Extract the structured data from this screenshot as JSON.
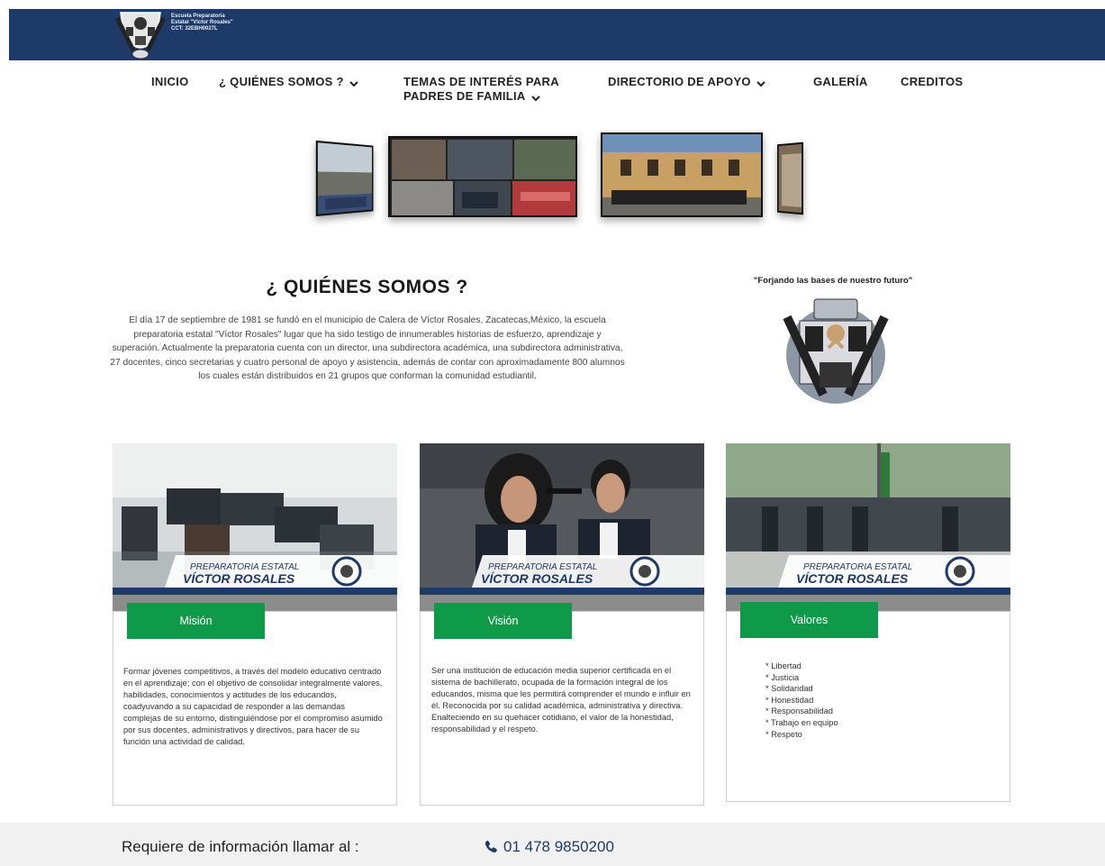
{
  "header": {
    "school_line1": "Escuela Preparatoria",
    "school_line2": "Estatal \"Víctor Rosales\"",
    "school_line3": "CCT: 32EBH0027L"
  },
  "nav": {
    "items": [
      {
        "label": "INICIO"
      },
      {
        "label": "¿ QUIÉNES SOMOS ?"
      },
      {
        "label_line1": "TEMAS DE INTERÉS PARA",
        "label_line2": "PADRES DE FAMILIA"
      },
      {
        "label": "DIRECTORIO DE APOYO"
      },
      {
        "label": "GALERÍA"
      },
      {
        "label": "CREDITOS"
      }
    ]
  },
  "about": {
    "title": "¿ QUIÉNES SOMOS ?",
    "text": "El día 17 de septiembre de 1981 se fundó en el municipio de Calera de Víctor Rosales, Zacatecas,México, la escuela preparatoria estatal \"Víctor Rosales\" lugar que ha sido testigo de innumerables historias de esfuerzo, aprendizaje y superación. Actualmente la preparatoria cuenta con un director, una subdirectora académica, una subdirectora administrativa, 27 docentes, cinco secretarias y cuatro personal de apoyo y asistencia, además de contar con aproximadamente 800 alumnos los cuales están distribuidos en 21 grupos que conforman la comunidad estudiantil.",
    "motto": "\"Forjando las bases de nuestro futuro\""
  },
  "banner": {
    "line1": "PREPARATORIA ESTATAL",
    "line2": "VÍCTOR ROSALES"
  },
  "cards": [
    {
      "tab": "Misión",
      "text": "Formar jóvenes competitivos, a través del modelo educativo centrado en el aprendizaje; con el objetivo de consolidar integralmente valores, habilidades, conocimientos y actitudes de los educandos, coadyuvando a su capacidad de responder a las demandas complejas de su entorno, distinguiéndose por el compromiso asumido por sus docentes, administrativos y directivos, para hacer de su función una actividad de calidad."
    },
    {
      "tab": "Visión",
      "text": "Ser una institución de educación media superior certificada en el sistema de bachillerato, ocupada de la formación integral de los educandos, misma que les permitirá comprender el mundo e influir en él. Reconocida por su calidad académica, administrativa y directiva. Enalteciendo en su quehacer cotidiano, el valor de la honestidad, responsabilidad y el respeto."
    },
    {
      "tab": "Valores",
      "values": [
        "* Libertad",
        "* Justicia",
        "* Solidaridad",
        "* Honestidad",
        "* Responsabilidad",
        "* Trabajo en equipo",
        "* Respeto"
      ]
    }
  ],
  "footer": {
    "label": "Requiere de información llamar al :",
    "phone": "01 478 9850200"
  },
  "colors": {
    "header_bg": "#1e3a68",
    "tab_green": "#0f9a4a",
    "footer_bg": "#f1f1f1"
  }
}
